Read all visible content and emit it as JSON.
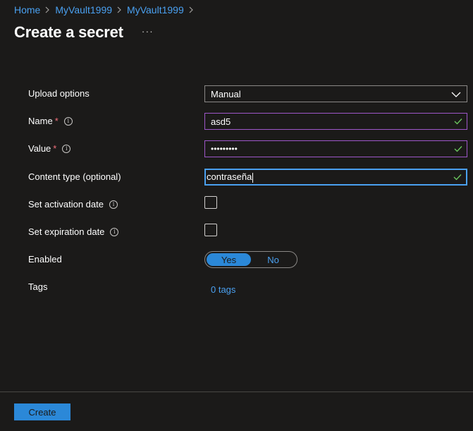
{
  "breadcrumb": {
    "items": [
      "Home",
      "MyVault1999",
      "MyVault1999"
    ]
  },
  "header": {
    "title": "Create a secret",
    "more": "···"
  },
  "form": {
    "upload_options": {
      "label": "Upload options",
      "value": "Manual"
    },
    "name": {
      "label": "Name",
      "required": "*",
      "value": "asd5"
    },
    "value": {
      "label": "Value",
      "required": "*",
      "value": "•••••••••"
    },
    "content_type": {
      "label": "Content type (optional)",
      "value": "contraseña"
    },
    "activation_date": {
      "label": "Set activation date",
      "checked": false
    },
    "expiration_date": {
      "label": "Set expiration date",
      "checked": false
    },
    "enabled": {
      "label": "Enabled",
      "yes": "Yes",
      "no": "No",
      "selected": "Yes"
    },
    "tags": {
      "label": "Tags",
      "link": "0 tags"
    }
  },
  "footer": {
    "create_label": "Create"
  },
  "colors": {
    "background": "#1b1a19",
    "accent": "#2b88d8",
    "link": "#4aa0f0",
    "valid_check": "#6ccb5f",
    "required": "#f1707b",
    "input_border_valid": "#9e57c9"
  }
}
